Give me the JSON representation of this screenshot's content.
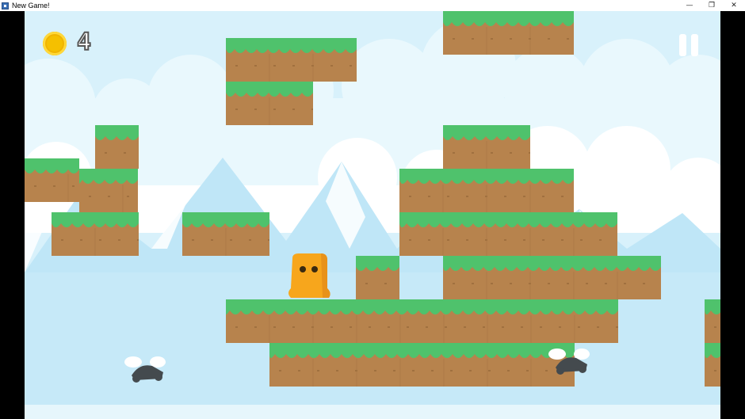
{
  "window": {
    "title": "New Game!",
    "minimize": "—",
    "restore": "❐",
    "close": "✕"
  },
  "hud": {
    "coin_count": "4",
    "coin_icon": "coin-icon",
    "pause_icon": "pause-icon"
  },
  "colors": {
    "sky": "#cfeefa",
    "grass": "#4fc26c",
    "dirt": "#b7834d",
    "player": "#f7a61c",
    "letterbox": "#000000"
  },
  "player": {
    "name": "orange-blob"
  },
  "enemies": [
    {
      "name": "flying-bug"
    },
    {
      "name": "flying-bug"
    }
  ]
}
